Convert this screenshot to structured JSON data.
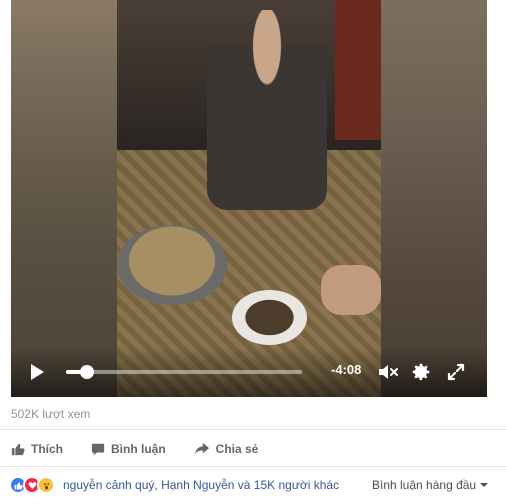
{
  "video": {
    "time_remaining": "-4:08",
    "progress": 0.09,
    "icons": [
      "play-icon",
      "volume-muted-icon",
      "settings-gear-icon",
      "fullscreen-icon"
    ]
  },
  "stats": {
    "views": "502K lượt xem"
  },
  "actions": {
    "like_label": "Thích",
    "comment_label": "Bình luận",
    "share_label": "Chia sẻ"
  },
  "reactions": {
    "summary": "nguyễn cảnh quý, Hạnh Nguyễn và 15K người khác",
    "sort_label": "Bình luận hàng đầu",
    "colors": {
      "like": "#3b7af4",
      "love": "#f0284a",
      "wow": "#f7c240"
    }
  }
}
